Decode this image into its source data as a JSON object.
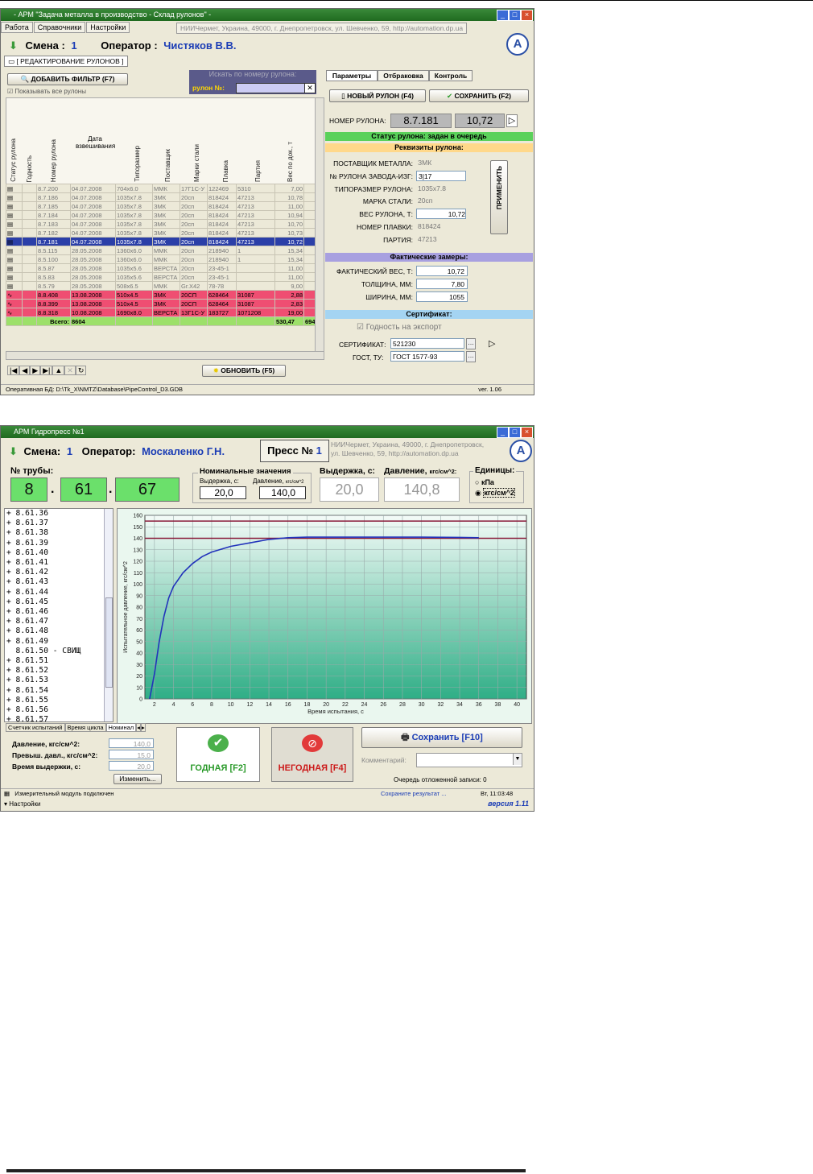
{
  "colors": {
    "title_green": "#2a7a2a",
    "selection_blue": "#2b3fa8",
    "reject_red": "#ef4e72",
    "status_green": "#5ad15a",
    "band_yellow": "#ffd88a",
    "band_purple": "#a8a0e0",
    "band_sky": "#a4d4f2",
    "chart_bg": "#e9f7f1",
    "curve_blue": "#2233bb",
    "limit_red": "#8a1a3a"
  },
  "win1": {
    "title": "- АРМ \"Задача металла в производство - Склад рулонов\" -",
    "menu": [
      "Работа",
      "Справочники",
      "Настройки"
    ],
    "org": "НИИЧермет, Украина, 49000, г. Днепропетровск, ул. Шевченко, 59, http://automation.dp.ua",
    "shift_label": "Смена :",
    "shift_value": "1",
    "operator_label": "Оператор :",
    "operator_value": "Чистяков В.В.",
    "doc_tab": "[ РЕДАКТИРОВАНИЕ РУЛОНОВ ]",
    "add_filter": "ДОБАВИТЬ ФИЛЬТР (F7)",
    "show_all": "Показывать все рулоны",
    "search_title": "Искать по номеру рулона:",
    "search_label": "рулон №:",
    "columns": [
      "Статус рулона",
      "Годность",
      "Номер рулона",
      "Дата взвешивания",
      "Типоразмер",
      "Поставщик",
      "Марки стали",
      "Плавка",
      "Партия",
      "Вес по док., т"
    ],
    "rows": [
      [
        "",
        "",
        "8.7.200",
        "04.07.2008",
        "704x6.0",
        "ММК",
        "17Г1С-У",
        "122469",
        "5310",
        "7,00"
      ],
      [
        "",
        "",
        "8.7.186",
        "04.07.2008",
        "1035x7.8",
        "ЗМК",
        "20сп",
        "818424",
        "47213",
        "10,78"
      ],
      [
        "",
        "",
        "8.7.185",
        "04.07.2008",
        "1035x7.8",
        "ЗМК",
        "20сп",
        "818424",
        "47213",
        "11,00"
      ],
      [
        "",
        "",
        "8.7.184",
        "04.07.2008",
        "1035x7.8",
        "ЗМК",
        "20сп",
        "818424",
        "47213",
        "10,94"
      ],
      [
        "",
        "",
        "8.7.183",
        "04.07.2008",
        "1035x7.8",
        "ЗМК",
        "20сп",
        "818424",
        "47213",
        "10,70"
      ],
      [
        "",
        "",
        "8.7.182",
        "04.07.2008",
        "1035x7.8",
        "ЗМК",
        "20сп",
        "818424",
        "47213",
        "10,73"
      ],
      [
        "",
        "",
        "8.7.181",
        "04.07.2008",
        "1035x7.8",
        "ЗМК",
        "20сп",
        "818424",
        "47213",
        "10,72"
      ],
      [
        "",
        "",
        "8.5.115",
        "28.05.2008",
        "1360x6.0",
        "ММК",
        "20сп",
        "218940",
        "1",
        "15,34"
      ],
      [
        "",
        "",
        "8.5.100",
        "28.05.2008",
        "1360x6.0",
        "ММК",
        "20сп",
        "218940",
        "1",
        "15,34"
      ],
      [
        "",
        "",
        "8.5.87",
        "28.05.2008",
        "1035x5.6",
        "ВЕРСТА",
        "20сп",
        "23-45-1",
        "",
        "11,00"
      ],
      [
        "",
        "",
        "8.5.83",
        "28.05.2008",
        "1035x5.6",
        "ВЕРСТА",
        "20сп",
        "23-45-1",
        "",
        "11,00"
      ],
      [
        "",
        "",
        "8.5.79",
        "28.05.2008",
        "508x6.5",
        "ММК",
        "Gr.X42",
        "78-78",
        "",
        "9,00"
      ],
      [
        "",
        "",
        "8.8.408",
        "13.08.2008",
        "510x4.5",
        "ЗМК",
        "20СП",
        "628464",
        "31087",
        "2,88"
      ],
      [
        "",
        "",
        "8.8.399",
        "13.08.2008",
        "510x4.5",
        "ЗМК",
        "20СП",
        "628464",
        "31087",
        "2,83"
      ],
      [
        "",
        "",
        "8.8.318",
        "10.08.2008",
        "1690x8.0",
        "ВЕРСТА",
        "13Г1С-У",
        "183727",
        "1071208",
        "19,00"
      ]
    ],
    "total_label": "Всего:",
    "total_count": "8604",
    "total_weight": "530,47",
    "total_extra": "694",
    "refresh": "ОБНОВИТЬ (F5)",
    "right_tabs": [
      "Параметры",
      "Отбраковка",
      "Контроль"
    ],
    "new_coil": "НОВЫЙ РУЛОН (F4)",
    "save": "СОХРАНИТЬ (F2)",
    "coil_number_label": "НОМЕР РУЛОНА:",
    "coil_number": "8.7.181",
    "coil_weight": "10,72",
    "status_band": "Статус рулона: задан в очередь",
    "requisites_band": "Реквизиты рулона:",
    "fields": [
      {
        "label": "ПОСТАВЩИК МЕТАЛЛА:",
        "value": "ЗМК"
      },
      {
        "label": "№ РУЛОНА ЗАВОДА-ИЗГ:",
        "value": "3|17"
      },
      {
        "label": "ТИПОРАЗМЕР РУЛОНА:",
        "value": "1035x7.8"
      },
      {
        "label": "МАРКА СТАЛИ:",
        "value": "20сп"
      },
      {
        "label": "ВЕС РУЛОНА, Т:",
        "value": "10,72"
      },
      {
        "label": "НОМЕР ПЛАВКИ:",
        "value": "818424"
      },
      {
        "label": "ПАРТИЯ:",
        "value": "47213"
      }
    ],
    "apply": "ПРИМЕНИТЬ",
    "actual_band": "Фактические замеры:",
    "actual_fields": [
      {
        "label": "ФАКТИЧЕСКИЙ ВЕС, Т:",
        "value": "10,72"
      },
      {
        "label": "ТОЛЩИНА, ММ:",
        "value": "7,80"
      },
      {
        "label": "ШИРИНА, ММ:",
        "value": "1055"
      }
    ],
    "cert_band": "Сертификат:",
    "export_label": "Годность на экспорт",
    "cert_label": "СЕРТИФИКАТ:",
    "cert_value": "521230",
    "gost_label": "ГОСТ, ТУ:",
    "gost_value": "ГОСТ 1577-93",
    "status_db": "Оперативная БД: D:\\Tk_X\\NMTZ\\Database\\PipeControl_D3.GDB",
    "version": "ver. 1.06"
  },
  "win2": {
    "title": "АРМ Гидропресс №1",
    "shift_label": "Смена:",
    "shift_value": "1",
    "operator_label": "Оператор:",
    "operator_value": "Москаленко Г.Н.",
    "press_label": "Пресс №",
    "press_value": "1",
    "org_line1": "НИИЧермет, Украина, 49000, г. Днепропетровск,",
    "org_line2": "ул. Шевченко, 59, http://automation.dp.ua",
    "pipe_label": "№ трубы:",
    "pipe_parts": [
      "8",
      "61",
      "67"
    ],
    "dot": ".",
    "nominal_label": "Номинальные значения",
    "hold_small": "Выдержка, с:",
    "pressure_small": "Давление,",
    "pressure_small_unit": "кгс/см^2",
    "hold_nominal": "20,0",
    "pressure_nominal": "140,0",
    "hold_label": "Выдержка, с:",
    "pressure_label": "Давление,",
    "pressure_unit": "кгс/см^2:",
    "hold_current": "20,0",
    "pressure_current": "140,8",
    "units_label": "Единицы:",
    "unit_kpa": "кПа",
    "unit_kgs": "кгс/см^2",
    "pipes": [
      "+ 8.61.36",
      "+ 8.61.37",
      "+ 8.61.38",
      "+ 8.61.39",
      "+ 8.61.40",
      "+ 8.61.41",
      "+ 8.61.42",
      "+ 8.61.43",
      "+ 8.61.44",
      "+ 8.61.45",
      "+ 8.61.46",
      "+ 8.61.47",
      "+ 8.61.48",
      "+ 8.61.49",
      "  8.61.50 - СВИЩ",
      "+ 8.61.51",
      "+ 8.61.52",
      "+ 8.61.53",
      "+ 8.61.54",
      "+ 8.61.55",
      "+ 8.61.56",
      "+ 8.61.57"
    ],
    "bottom_tabs": [
      "Счетчик испытаний",
      "Время цикла",
      "Номинал"
    ],
    "params": [
      {
        "label": "Давление, кгс/см^2:",
        "value": "140,0"
      },
      {
        "label": "Превыш. давл., кгс/см^2:",
        "value": "15,0"
      },
      {
        "label": "Время выдержки, с:",
        "value": "20,0"
      }
    ],
    "change": "Изменить...",
    "good": "ГОДНАЯ  [F2]",
    "bad": "НЕГОДНАЯ  [F4]",
    "save": "Сохранить [F10]",
    "comment_label": "Комментарий:",
    "queue": "Очередь отложенной записи: 0",
    "status_left": "Измерительный модуль подключен",
    "status_mid": "Сохраните результат ...",
    "status_time": "Вт, 11:03:48",
    "settings": "Настройки",
    "version": "версия 1.11"
  },
  "chart_data": {
    "type": "line",
    "title": "",
    "xlabel": "Время испытания, с",
    "ylabel": "Испытательное давление, кгс/см^2",
    "xlim": [
      1,
      41
    ],
    "ylim": [
      0,
      160
    ],
    "xticks": [
      2,
      4,
      6,
      8,
      10,
      12,
      14,
      16,
      18,
      20,
      22,
      24,
      26,
      28,
      30,
      32,
      34,
      36,
      38,
      40
    ],
    "yticks": [
      0,
      10,
      20,
      30,
      40,
      50,
      60,
      70,
      80,
      90,
      100,
      110,
      120,
      130,
      140,
      150,
      160
    ],
    "limits": [
      155,
      140
    ],
    "grid": true,
    "series": [
      {
        "values": [
          [
            1.5,
            0
          ],
          [
            2,
            22
          ],
          [
            2.5,
            50
          ],
          [
            3,
            72
          ],
          [
            3.5,
            88
          ],
          [
            4,
            98
          ],
          [
            5,
            110
          ],
          [
            6,
            118
          ],
          [
            7,
            124
          ],
          [
            8,
            128
          ],
          [
            10,
            133
          ],
          [
            12,
            136
          ],
          [
            14,
            139
          ],
          [
            16,
            140.5
          ],
          [
            18,
            141
          ],
          [
            20,
            141
          ],
          [
            22,
            141
          ],
          [
            26,
            141
          ],
          [
            30,
            141
          ],
          [
            34,
            140.8
          ],
          [
            36,
            140.5
          ]
        ]
      }
    ]
  }
}
